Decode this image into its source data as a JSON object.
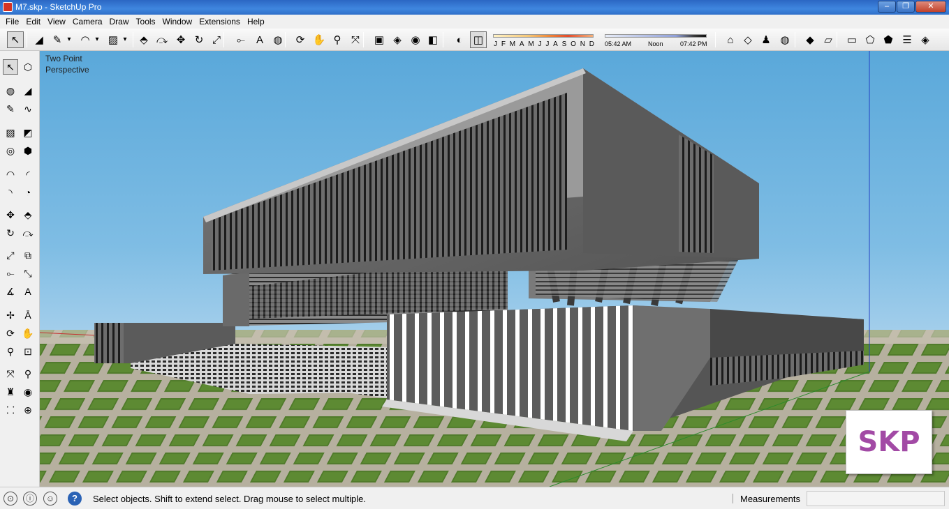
{
  "window": {
    "title": "M7.skp - SketchUp Pro",
    "controls": {
      "minimize": "–",
      "maximize": "❐",
      "close": "✕"
    }
  },
  "menu": [
    "File",
    "Edit",
    "View",
    "Camera",
    "Draw",
    "Tools",
    "Window",
    "Extensions",
    "Help"
  ],
  "toolbar": {
    "tools": [
      {
        "name": "select-tool",
        "glyph": "↖"
      },
      {
        "name": "eraser-tool",
        "glyph": "◢"
      },
      {
        "name": "pencil-tool",
        "glyph": "✎"
      },
      {
        "name": "pencil-dropdown",
        "glyph": "▾"
      },
      {
        "name": "arc-tool",
        "glyph": "◠"
      },
      {
        "name": "arc-dropdown",
        "glyph": "▾"
      },
      {
        "name": "rectangle-tool",
        "glyph": "▨"
      },
      {
        "name": "rectangle-dropdown",
        "glyph": "▾"
      },
      {
        "name": "push-pull-tool",
        "glyph": "⬘"
      },
      {
        "name": "follow-me-tool",
        "glyph": "⤼"
      },
      {
        "name": "move-tool",
        "glyph": "✥"
      },
      {
        "name": "rotate-tool",
        "glyph": "↻"
      },
      {
        "name": "scale-tool",
        "glyph": "⤢"
      },
      {
        "name": "tape-measure-tool",
        "glyph": "⟜"
      },
      {
        "name": "text-tool",
        "glyph": "A"
      },
      {
        "name": "paint-bucket-tool",
        "glyph": "◍"
      },
      {
        "name": "orbit-tool",
        "glyph": "⟳"
      },
      {
        "name": "pan-tool",
        "glyph": "✋"
      },
      {
        "name": "zoom-tool",
        "glyph": "⚲"
      },
      {
        "name": "zoom-extents-tool",
        "glyph": "⤧"
      },
      {
        "name": "warehouse-tool",
        "glyph": "▣"
      },
      {
        "name": "share-model-tool",
        "glyph": "◈"
      },
      {
        "name": "components-tool",
        "glyph": "◉"
      },
      {
        "name": "extension-warehouse-tool",
        "glyph": "◧"
      },
      {
        "name": "shadows-toggle",
        "glyph": "◐"
      },
      {
        "name": "shadow-settings",
        "glyph": "◫"
      },
      {
        "name": "geo-location-tool",
        "glyph": "⌂"
      },
      {
        "name": "styles-tool",
        "glyph": "◇"
      },
      {
        "name": "add-location-tool",
        "glyph": "♟"
      },
      {
        "name": "google-earth-tool",
        "glyph": "◍"
      },
      {
        "name": "iso-view",
        "glyph": "◆"
      },
      {
        "name": "top-view",
        "glyph": "▱"
      },
      {
        "name": "front-view",
        "glyph": "▭"
      },
      {
        "name": "right-view",
        "glyph": "⬠"
      },
      {
        "name": "back-view",
        "glyph": "⬟"
      },
      {
        "name": "left-view",
        "glyph": "☰"
      },
      {
        "name": "bottom-view",
        "glyph": "◈"
      }
    ],
    "months": [
      "J",
      "F",
      "M",
      "A",
      "M",
      "J",
      "J",
      "A",
      "S",
      "O",
      "N",
      "D"
    ],
    "time_start": "05:42 AM",
    "time_mid": "Noon",
    "time_end": "07:42 PM"
  },
  "left_tools": [
    {
      "name": "select-tool",
      "glyph": "↖"
    },
    {
      "name": "make-component-tool",
      "glyph": "⬡"
    },
    {
      "name": "paint-bucket-tool",
      "glyph": "◍"
    },
    {
      "name": "eraser-tool",
      "glyph": "◢"
    },
    {
      "name": "line-tool",
      "glyph": "✎"
    },
    {
      "name": "freehand-tool",
      "glyph": "∿"
    },
    {
      "name": "rectangle-tool",
      "glyph": "▨"
    },
    {
      "name": "rotated-rectangle-tool",
      "glyph": "◩"
    },
    {
      "name": "circle-tool",
      "glyph": "◎"
    },
    {
      "name": "polygon-tool",
      "glyph": "⬢"
    },
    {
      "name": "arc-tool",
      "glyph": "◠"
    },
    {
      "name": "two-point-arc-tool",
      "glyph": "◜"
    },
    {
      "name": "three-point-arc-tool",
      "glyph": "◝"
    },
    {
      "name": "pie-tool",
      "glyph": "◔"
    },
    {
      "name": "move-tool",
      "glyph": "✥"
    },
    {
      "name": "push-pull-tool",
      "glyph": "⬘"
    },
    {
      "name": "rotate-tool",
      "glyph": "↻"
    },
    {
      "name": "follow-me-tool",
      "glyph": "⤼"
    },
    {
      "name": "scale-tool",
      "glyph": "⤢"
    },
    {
      "name": "offset-tool",
      "glyph": "⧉"
    },
    {
      "name": "tape-measure-tool",
      "glyph": "⟜"
    },
    {
      "name": "dimension-tool",
      "glyph": "⤡"
    },
    {
      "name": "protractor-tool",
      "glyph": "∡"
    },
    {
      "name": "text-tool",
      "glyph": "A"
    },
    {
      "name": "axes-tool",
      "glyph": "✢"
    },
    {
      "name": "3d-text-tool",
      "glyph": "Ā"
    },
    {
      "name": "orbit-tool",
      "glyph": "⟳"
    },
    {
      "name": "pan-tool",
      "glyph": "✋"
    },
    {
      "name": "zoom-tool",
      "glyph": "⚲"
    },
    {
      "name": "zoom-window-tool",
      "glyph": "⊡"
    },
    {
      "name": "zoom-extents-tool",
      "glyph": "⤧"
    },
    {
      "name": "previous-view-tool",
      "glyph": "⚲"
    },
    {
      "name": "position-camera-tool",
      "glyph": "♜"
    },
    {
      "name": "look-around-tool",
      "glyph": "◉"
    },
    {
      "name": "walk-tool",
      "glyph": "⸬"
    },
    {
      "name": "section-plane-tool",
      "glyph": "⊕"
    }
  ],
  "viewport": {
    "scene_label_line1": "Two Point",
    "scene_label_line2": "Perspective",
    "badge_text": "SKP"
  },
  "statusbar": {
    "geo_icon": "⊙",
    "info_icon": "ⓘ",
    "user_icon": "☺",
    "help_icon": "?",
    "message": "Select objects. Shift to extend select. Drag mouse to select multiple.",
    "measurements_label": "Measurements",
    "measurements_value": ""
  }
}
